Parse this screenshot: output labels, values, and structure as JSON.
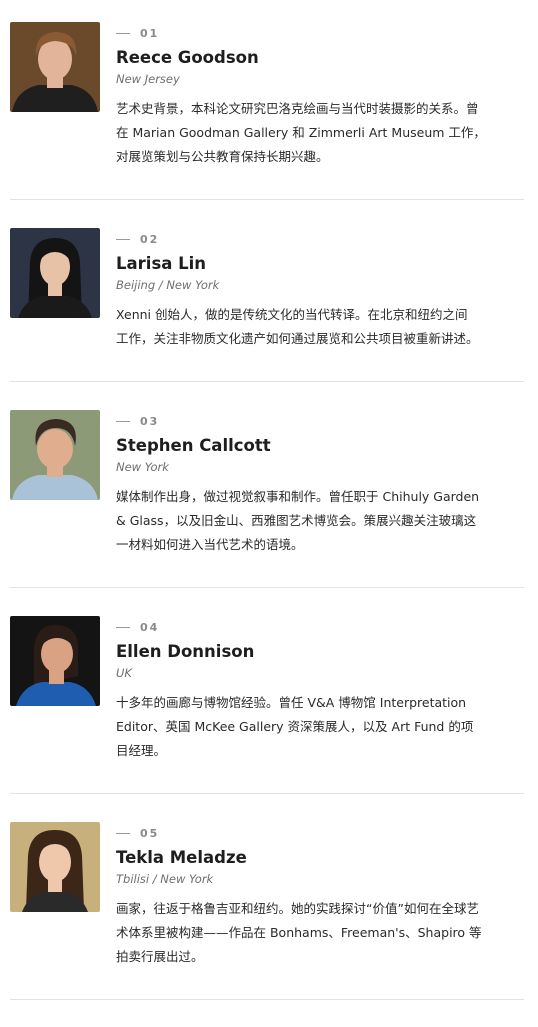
{
  "members": [
    {
      "index": "01",
      "name": "Reece Goodson",
      "location": "New Jersey",
      "bio_lines": [
        "艺术史背景，本科论文研究巴洛克绘画与当代时装摄影的关系。曾",
        "在 Marian Goodman Gallery 和 Zimmerli Art Museum 工作，",
        "对展览策划与公共教育保持长期兴趣。"
      ],
      "photo": {
        "bg": "#6b4a2c",
        "skin": "#e2b59b",
        "hair": "#8a5a34",
        "clothing": "#1f1f1f"
      }
    },
    {
      "index": "02",
      "name": "Larisa Lin",
      "location": "Beijing / New York",
      "bio_lines": [
        "Xenni 创始人，做的是传统文化的当代转译。在北京和纽约之间",
        "工作，关注非物质文化遗产如何通过展览和公共项目被重新讲述。"
      ],
      "photo": {
        "bg": "#2c3446",
        "skin": "#e8c2a6",
        "hair": "#141414",
        "clothing": "#1a1a1a"
      }
    },
    {
      "index": "03",
      "name": "Stephen Callcott",
      "location": "New York",
      "bio_lines": [
        "媒体制作出身，做过视觉叙事和制作。曾任职于 Chihuly Garden",
        "& Glass，以及旧金山、西雅图艺术博览会。策展兴趣关注玻璃这",
        "一材料如何进入当代艺术的语境。"
      ],
      "photo": {
        "bg": "#8c9a78",
        "skin": "#e0ad8e",
        "hair": "#3a2a22",
        "clothing": "#aac2d8"
      }
    },
    {
      "index": "04",
      "name": "Ellen Donnison",
      "location": "UK",
      "bio_lines": [
        "十多年的画廊与博物馆经验。曾任 V&A 博物馆 Interpretation",
        "Editor、英国 McKee Gallery 资深策展人，以及 Art Fund 的项",
        "目经理。"
      ],
      "photo": {
        "bg": "#141414",
        "skin": "#d8a283",
        "hair": "#2a1c16",
        "clothing": "#1e5db0"
      }
    },
    {
      "index": "05",
      "name": "Tekla Meladze",
      "location": "Tbilisi / New York",
      "bio_lines": [
        "画家，往返于格鲁吉亚和纽约。她的实践探讨“价值”如何在全球艺",
        "术体系里被构建——作品在 Bonhams、Freeman's、Shapiro 等",
        "拍卖行展出过。"
      ],
      "photo": {
        "bg": "#c8b07c",
        "skin": "#efc8ab",
        "hair": "#3c2618",
        "clothing": "#2a2a2a"
      }
    }
  ]
}
